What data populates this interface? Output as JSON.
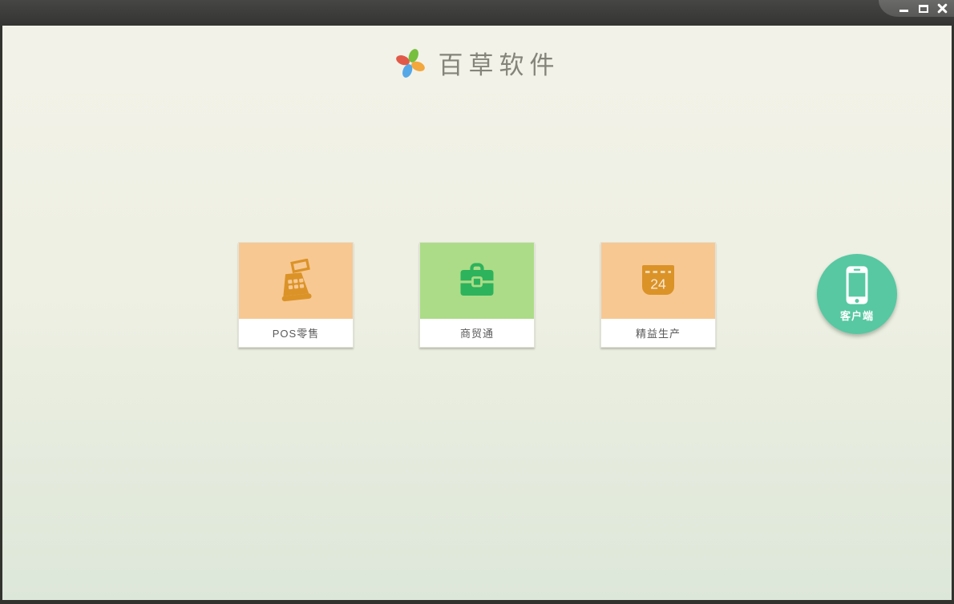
{
  "window": {
    "controls": {
      "minimize_icon": "minimize-icon",
      "maximize_icon": "maximize-icon",
      "close_icon": "close-icon"
    }
  },
  "brand": {
    "logo_icon": "pinwheel-icon",
    "title": "百草软件",
    "logo_colors": {
      "top_petal": "#76bf3f",
      "right_petal": "#f3a73d",
      "bottom_petal": "#55a8e8",
      "left_petal": "#e15a49"
    }
  },
  "products": [
    {
      "label": "POS零售",
      "icon": "cash-register-icon",
      "tile_color": "#f7c892",
      "icon_color": "#db9328"
    },
    {
      "label": "商贸通",
      "icon": "briefcase-icon",
      "tile_color": "#acdc87",
      "icon_color": "#2db35c"
    },
    {
      "label": "精益生产",
      "icon": "calendar-icon",
      "calendar_day": "24",
      "tile_color": "#f7c892",
      "icon_color": "#db9328"
    }
  ],
  "client": {
    "label": "客户端",
    "icon": "smartphone-icon",
    "bg_color": "#57c8a2"
  },
  "theme": {
    "titlebar_top": "#464644",
    "titlebar_bottom": "#343432",
    "content_top": "#f3f2e9",
    "content_bottom": "#dde7d9",
    "card_label_color": "#5a5a5a",
    "brand_title_color": "#84847a"
  }
}
